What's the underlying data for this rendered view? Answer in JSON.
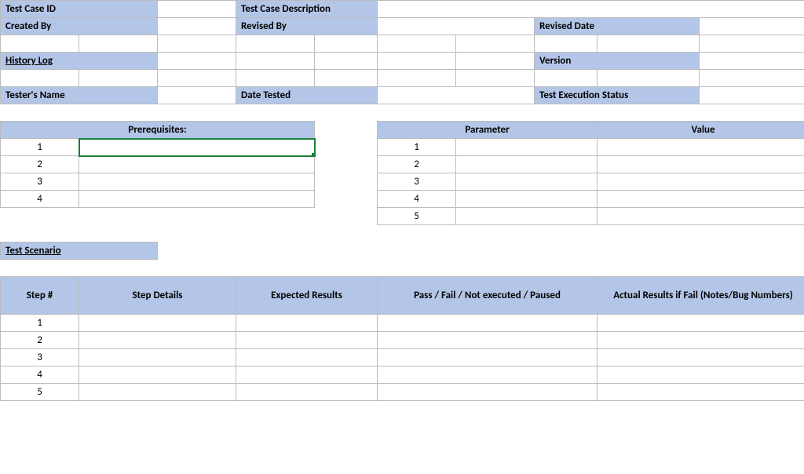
{
  "labels": {
    "test_case_id": "Test Case ID",
    "test_case_description": "Test Case Description",
    "created_by": "Created By",
    "revised_by": "Revised By",
    "revised_date": "Revised Date",
    "history_log": "History Log",
    "version": "Version",
    "testers_name": "Tester's Name",
    "date_tested": "Date Tested",
    "test_exec_status": "Test Execution Status",
    "prerequisites": "Prerequisites:",
    "parameter": "Parameter",
    "value": "Value",
    "test_scenario": "Test Scenario",
    "step_num": "Step #",
    "step_details": "Step Details",
    "expected_results": "Expected Results",
    "pass_fail": "Pass / Fail / Not executed / Paused",
    "actual_results": "Actual Results if Fail (Notes/Bug Numbers)"
  },
  "values": {
    "test_case_id": "",
    "test_case_description": "",
    "created_by": "",
    "revised_by": "",
    "revised_date": "",
    "history_log": "",
    "version": "",
    "testers_name": "",
    "date_tested": "",
    "test_exec_status": ""
  },
  "prerequisites": [
    {
      "n": "1",
      "text": ""
    },
    {
      "n": "2",
      "text": ""
    },
    {
      "n": "3",
      "text": ""
    },
    {
      "n": "4",
      "text": ""
    }
  ],
  "parameters": [
    {
      "n": "1",
      "param": "",
      "value": ""
    },
    {
      "n": "2",
      "param": "",
      "value": ""
    },
    {
      "n": "3",
      "param": "",
      "value": ""
    },
    {
      "n": "4",
      "param": "",
      "value": ""
    },
    {
      "n": "5",
      "param": "",
      "value": ""
    }
  ],
  "steps": [
    {
      "n": "1",
      "details": "",
      "expected": "",
      "status": "",
      "actual": ""
    },
    {
      "n": "2",
      "details": "",
      "expected": "",
      "status": "",
      "actual": ""
    },
    {
      "n": "3",
      "details": "",
      "expected": "",
      "status": "",
      "actual": ""
    },
    {
      "n": "4",
      "details": "",
      "expected": "",
      "status": "",
      "actual": ""
    },
    {
      "n": "5",
      "details": "",
      "expected": "",
      "status": "",
      "actual": ""
    }
  ]
}
